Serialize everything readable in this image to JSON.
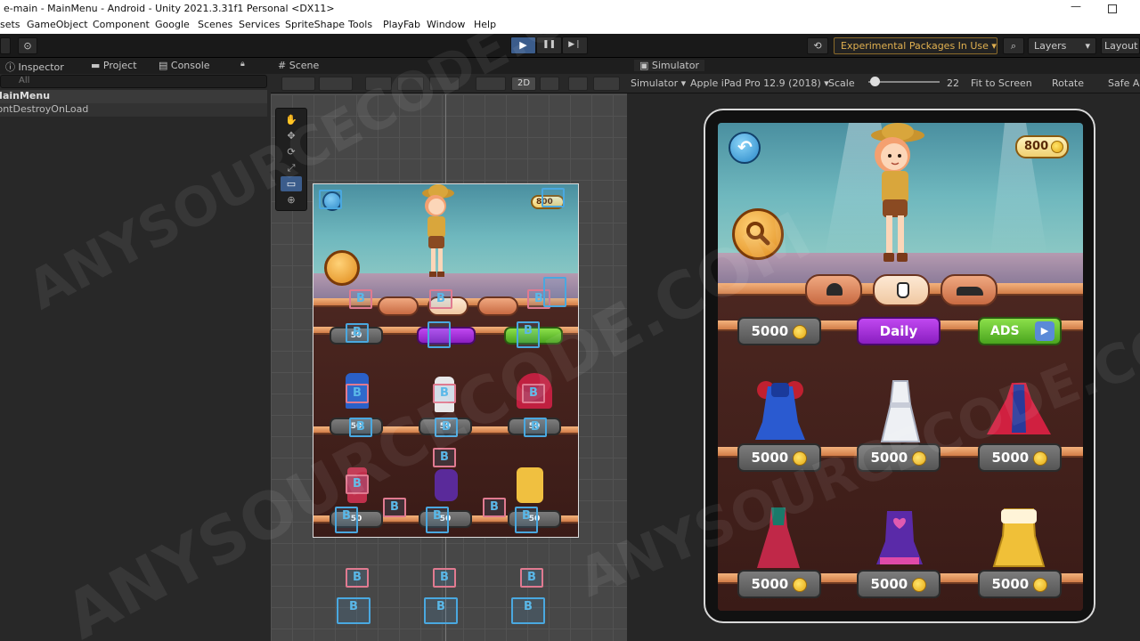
{
  "window": {
    "title": "e-main - MainMenu - Android - Unity 2021.3.31f1 Personal <DX11>",
    "minimize_glyph": "—"
  },
  "menubar": [
    "sets",
    "GameObject",
    "Component",
    "Google",
    "Scenes",
    "Services",
    "SpriteShape",
    "Tools",
    "PlayFab",
    "Window",
    "Help"
  ],
  "toolbar": {
    "play_glyph": "▶",
    "pause_glyph": "❚❚",
    "step_glyph": "▶❘",
    "history_glyph": "⟲",
    "packages_label": "Experimental Packages In Use ▾",
    "search_glyph": "⌕",
    "layers_label": "Layers",
    "layers_chevron": "▾",
    "layout_label": "Layout"
  },
  "left_panel": {
    "tabs": [
      "Inspector",
      "Project",
      "Console"
    ],
    "lock_glyph": "🔒︎",
    "search_placeholder": "All",
    "hierarchy": [
      "MainMenu",
      "DontDestroyOnLoad"
    ]
  },
  "scene_panel": {
    "tab": "Scene",
    "two_d_label": "2D",
    "tools": [
      "✋",
      "✥",
      "⟳",
      "⤢",
      "▭",
      "⊕"
    ],
    "handle_label": "B",
    "mini": {
      "coin_text": "800",
      "price_text": "50",
      "tab_letter": "B"
    }
  },
  "simulator": {
    "tab": "Simulator",
    "bar": {
      "mode": "Simulator ▾",
      "device": "Apple iPad Pro 12.9 (2018) ▾",
      "scale_label": "Scale",
      "scale_value": "22",
      "fit_label": "Fit to Screen",
      "rotate_label": "Rotate",
      "safe_area_label": "Safe A"
    },
    "game": {
      "coin_balance": "800",
      "daily_label": "Daily",
      "ads_label": "ADS",
      "top_row_price": "5000",
      "outfit_prices": [
        "5000",
        "5000",
        "5000",
        "5000",
        "5000",
        "5000"
      ],
      "category_tabs": [
        "helmet",
        "dress",
        "shoe"
      ],
      "selected_category": 1
    }
  },
  "watermark_text": "ANYSOURCECODE.COM",
  "colors": {
    "play_active": "#3b5c8b",
    "daily_button": "#b03ee8",
    "ads_button": "#6cc83a",
    "price_button": "#6a6a6a",
    "coin": "#f5c430"
  }
}
